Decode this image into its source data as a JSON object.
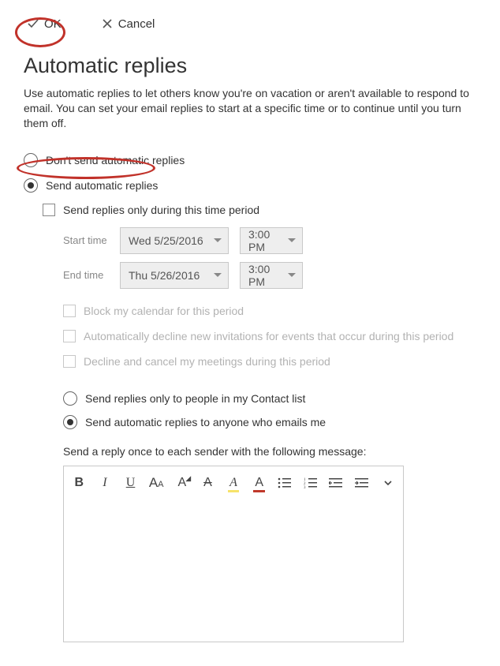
{
  "toolbar": {
    "ok_label": "OK",
    "cancel_label": "Cancel"
  },
  "page": {
    "title": "Automatic replies",
    "description": "Use automatic replies to let others know you're on vacation or aren't available to respond to email. You can set your email replies to start at a specific time or to continue until you turn them off."
  },
  "options": {
    "dont_send_label": "Don't send automatic replies",
    "send_label": "Send automatic replies",
    "period_label": "Send replies only during this time period",
    "start_label": "Start time",
    "start_date": "Wed 5/25/2016",
    "start_time": "3:00 PM",
    "end_label": "End time",
    "end_date": "Thu 5/26/2016",
    "end_time": "3:00 PM",
    "block_calendar": "Block my calendar for this period",
    "auto_decline": "Automatically decline new invitations for events that occur during this period",
    "decline_cancel": "Decline and cancel my meetings during this period"
  },
  "recipients": {
    "contacts_only": "Send replies only to people in my Contact list",
    "anyone": "Send automatic replies to anyone who emails me"
  },
  "message": {
    "label": "Send a reply once to each sender with the following message:"
  },
  "editor_icons": {
    "bold": "B",
    "italic": "I",
    "underline": "U",
    "fontsize": "A",
    "fontsize_sub": "A",
    "strike": "A",
    "highlight": "A",
    "color": "A"
  }
}
